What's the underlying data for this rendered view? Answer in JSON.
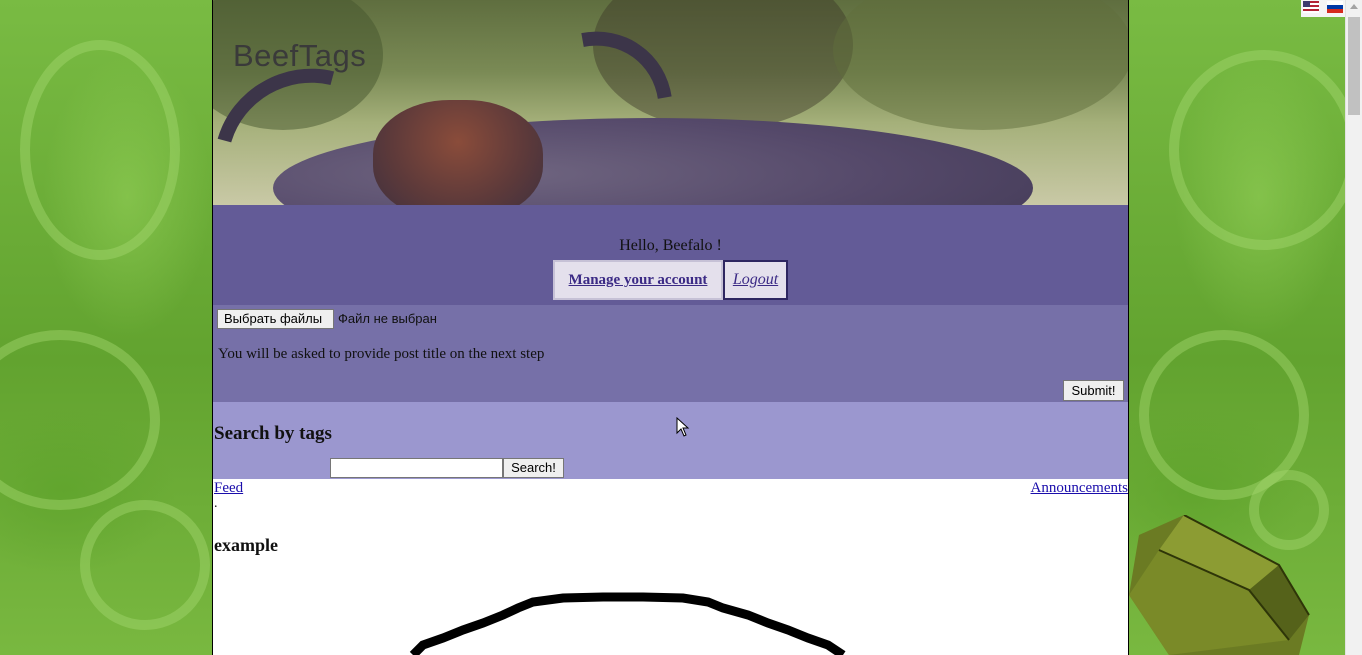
{
  "header": {
    "site_title": "BeefTags"
  },
  "account": {
    "greeting": "Hello, Beefalo !",
    "manage_label": "Manage your account",
    "logout_label": "Logout"
  },
  "upload": {
    "choose_files_label": "Выбрать файлы",
    "file_status": "Файл не выбран",
    "hint": "You will be asked to provide post title on the next step",
    "submit_label": "Submit!"
  },
  "search": {
    "heading": "Search by tags",
    "input_value": "",
    "button_label": "Search!"
  },
  "nav": {
    "feed_label": "Feed",
    "announcements_label": "Announcements",
    "separator": "."
  },
  "post": {
    "title": "example"
  },
  "languages": [
    {
      "name": "flag-us-icon",
      "label": "English"
    },
    {
      "name": "flag-ru-icon",
      "label": "Russian"
    }
  ],
  "colors": {
    "account_bar": "#635b97",
    "upload_bar": "#7670a8",
    "search_bar": "#9b97cf",
    "background_green": "#6fb03a",
    "link": "#1a0dab"
  }
}
